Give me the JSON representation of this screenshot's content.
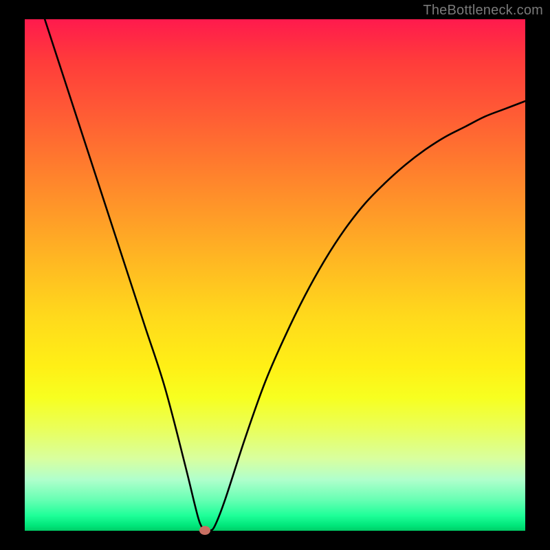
{
  "watermark": "TheBottleneck.com",
  "colors": {
    "background": "#000000",
    "curve": "#000000",
    "marker": "#c96f62"
  },
  "chart_data": {
    "type": "line",
    "title": "",
    "xlabel": "",
    "ylabel": "",
    "xlim": [
      0,
      100
    ],
    "ylim": [
      0,
      100
    ],
    "annotations": [],
    "legend": [],
    "marker": {
      "x": 36,
      "y": 0
    },
    "series": [
      {
        "name": "curve",
        "x": [
          4,
          8,
          12,
          16,
          20,
          24,
          28,
          32,
          34,
          35,
          36,
          37,
          38,
          40,
          44,
          48,
          52,
          56,
          60,
          64,
          68,
          72,
          76,
          80,
          84,
          88,
          92,
          96,
          100
        ],
        "y": [
          100,
          88,
          76,
          64,
          52,
          40,
          28,
          13,
          5,
          1.5,
          0,
          0,
          1,
          6,
          18,
          29,
          38,
          46,
          53,
          59,
          64,
          68,
          71.5,
          74.5,
          77,
          79,
          81,
          82.5,
          84
        ]
      }
    ]
  }
}
